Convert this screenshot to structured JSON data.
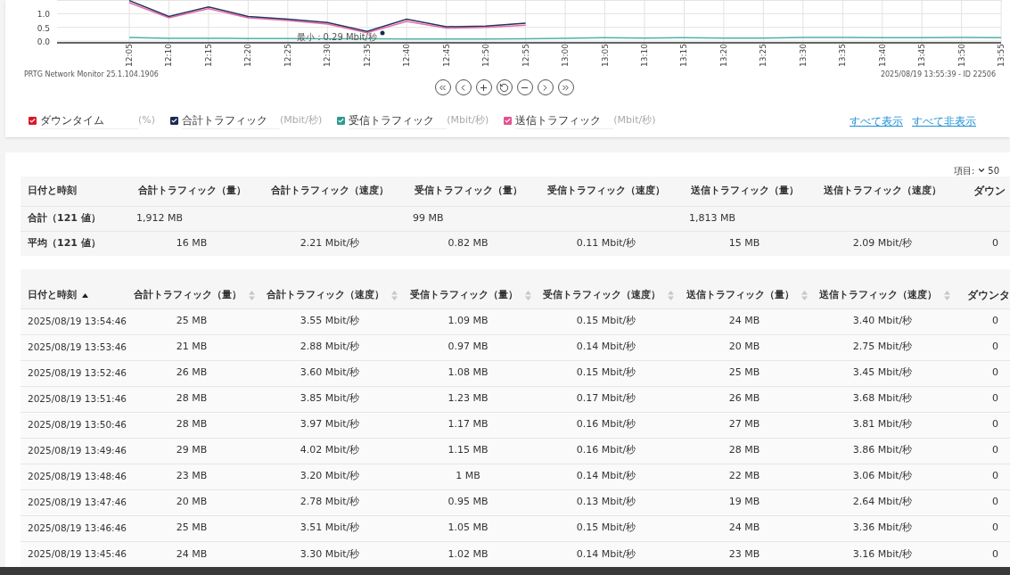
{
  "chart": {
    "chart_data": {
      "type": "line",
      "grid": true,
      "x": [
        "12:05",
        "12:10",
        "12:15",
        "12:20",
        "12:25",
        "12:30",
        "12:35",
        "12:40",
        "12:45",
        "12:50",
        "12:55",
        "13:00",
        "13:05",
        "13:10",
        "13:15",
        "13:20",
        "13:25",
        "13:30",
        "13:35",
        "13:40",
        "13:45",
        "13:50",
        "13:55"
      ],
      "series": [
        {
          "color": "#e86aa8",
          "values": [
            1.4,
            0.85,
            1.18,
            0.85,
            0.75,
            0.62,
            0.3,
            0.72,
            0.47,
            0.5,
            0.58,
            null,
            null,
            null,
            null,
            null,
            null,
            null,
            null,
            null,
            null,
            null,
            null
          ]
        },
        {
          "color": "#27315e",
          "values": [
            1.48,
            0.9,
            1.25,
            0.9,
            0.8,
            0.68,
            0.35,
            0.8,
            0.52,
            0.55,
            0.65,
            null,
            null,
            null,
            null,
            null,
            null,
            null,
            null,
            null,
            null,
            null,
            null
          ]
        },
        {
          "color": "#4fb3a9",
          "values": [
            0.13,
            0.1,
            0.1,
            0.09,
            0.09,
            0.08,
            0.08,
            0.07,
            0.07,
            0.07,
            0.08,
            0.1,
            0.12,
            0.11,
            0.12,
            0.11,
            0.11,
            0.13,
            0.13,
            0.12,
            0.12,
            0.13,
            0.12
          ]
        }
      ],
      "ylim": [
        0,
        1.5
      ],
      "yticks": [
        {
          "value": 0,
          "label": "0.0"
        },
        {
          "value": 0.5,
          "label": "0.5"
        },
        {
          "value": 1,
          "label": "1.0"
        }
      ],
      "annotations": [
        "最小：0.29 Mbit/秒"
      ]
    },
    "footer_left": "PRTG Network Monitor 25.1.104.1906",
    "footer_right": "2025/08/19 13:55:39 - ID 22506"
  },
  "legend": {
    "items": [
      {
        "label": "ダウンタイム",
        "unit": "(%)",
        "checked": true,
        "color": "#d9172b"
      },
      {
        "label": "合計トラフィック",
        "unit": "(Mbit/秒)",
        "checked": true,
        "color": "#1b2a55"
      },
      {
        "label": "受信トラフィック",
        "unit": "(Mbit/秒)",
        "checked": true,
        "color": "#2e9b8f"
      },
      {
        "label": "送信トラフィック",
        "unit": "(Mbit/秒)",
        "checked": true,
        "color": "#e8508e"
      }
    ],
    "links": [
      "すべて表示",
      "すべて非表示"
    ]
  },
  "items_per_page": {
    "label": "項目:",
    "value": "50"
  },
  "summary": {
    "columns": [
      "日付と時刻",
      "合計トラフィック（量）",
      "合計トラフィック（速度）",
      "受信トラフィック（量）",
      "受信トラフィック（速度）",
      "送信トラフィック（量）",
      "送信トラフィック（速度）",
      "ダウン"
    ],
    "rows": [
      {
        "kind": "totals",
        "label": "合計（121 値）",
        "values": [
          "1,912 MB",
          "99 MB",
          "1,813 MB"
        ]
      },
      {
        "kind": "averages",
        "label": "平均（121 値）",
        "values": [
          "16 MB",
          "2.21 Mbit/秒",
          "0.82 MB",
          "0.11 Mbit/秒",
          "15 MB",
          "2.09 Mbit/秒",
          "0"
        ]
      }
    ]
  },
  "table": {
    "columns": [
      {
        "label": "日付と時刻",
        "sorted": true
      },
      {
        "label": "合計トラフィック（量）",
        "sorted": false
      },
      {
        "label": "合計トラフィック（速度）",
        "sorted": false
      },
      {
        "label": "受信トラフィック（量）",
        "sorted": false
      },
      {
        "label": "受信トラフィック（速度）",
        "sorted": false
      },
      {
        "label": "送信トラフィック（量）",
        "sorted": false
      },
      {
        "label": "送信トラフィック（速度）",
        "sorted": false
      },
      {
        "label": "ダウンタ"
      }
    ],
    "rows": [
      [
        "2025/08/19 13:54:46",
        "25 MB",
        "3.55 Mbit/秒",
        "1.09 MB",
        "0.15 Mbit/秒",
        "24 MB",
        "3.40 Mbit/秒",
        "0"
      ],
      [
        "2025/08/19 13:53:46",
        "21 MB",
        "2.88 Mbit/秒",
        "0.97 MB",
        "0.14 Mbit/秒",
        "20 MB",
        "2.75 Mbit/秒",
        "0"
      ],
      [
        "2025/08/19 13:52:46",
        "26 MB",
        "3.60 Mbit/秒",
        "1.08 MB",
        "0.15 Mbit/秒",
        "25 MB",
        "3.45 Mbit/秒",
        "0"
      ],
      [
        "2025/08/19 13:51:46",
        "28 MB",
        "3.85 Mbit/秒",
        "1.23 MB",
        "0.17 Mbit/秒",
        "26 MB",
        "3.68 Mbit/秒",
        "0"
      ],
      [
        "2025/08/19 13:50:46",
        "28 MB",
        "3.97 Mbit/秒",
        "1.17 MB",
        "0.16 Mbit/秒",
        "27 MB",
        "3.81 Mbit/秒",
        "0"
      ],
      [
        "2025/08/19 13:49:46",
        "29 MB",
        "4.02 Mbit/秒",
        "1.15 MB",
        "0.16 Mbit/秒",
        "28 MB",
        "3.86 Mbit/秒",
        "0"
      ],
      [
        "2025/08/19 13:48:46",
        "23 MB",
        "3.20 Mbit/秒",
        "1 MB",
        "0.14 Mbit/秒",
        "22 MB",
        "3.06 Mbit/秒",
        "0"
      ],
      [
        "2025/08/19 13:47:46",
        "20 MB",
        "2.78 Mbit/秒",
        "0.95 MB",
        "0.13 Mbit/秒",
        "19 MB",
        "2.64 Mbit/秒",
        "0"
      ],
      [
        "2025/08/19 13:46:46",
        "25 MB",
        "3.51 Mbit/秒",
        "1.05 MB",
        "0.15 Mbit/秒",
        "24 MB",
        "3.36 Mbit/秒",
        "0"
      ],
      [
        "2025/08/19 13:45:46",
        "24 MB",
        "3.30 Mbit/秒",
        "1.02 MB",
        "0.14 Mbit/秒",
        "23 MB",
        "3.16 Mbit/秒",
        "0"
      ]
    ]
  }
}
